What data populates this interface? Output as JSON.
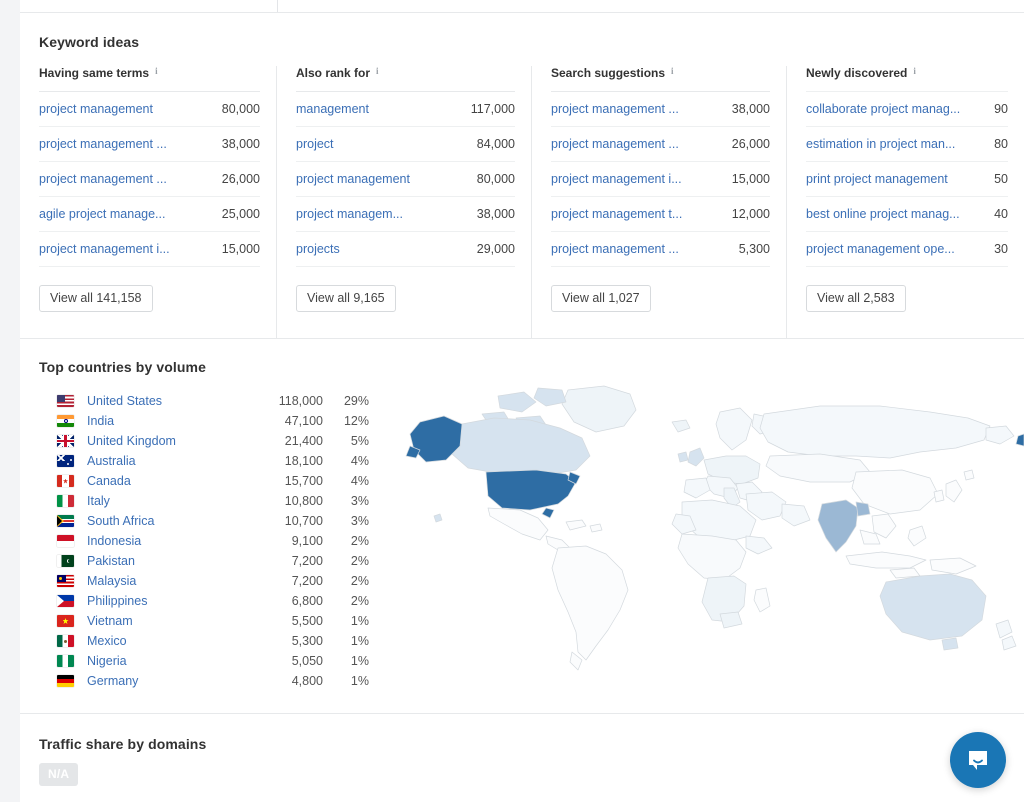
{
  "keyword_ideas": {
    "title": "Keyword ideas",
    "columns": [
      {
        "header": "Having same terms",
        "info_icon": "info-icon",
        "rows": [
          {
            "term": "project management",
            "volume": "80,000"
          },
          {
            "term": "project management ...",
            "volume": "38,000"
          },
          {
            "term": "project management ...",
            "volume": "26,000"
          },
          {
            "term": "agile project manage...",
            "volume": "25,000"
          },
          {
            "term": "project management i...",
            "volume": "15,000"
          }
        ],
        "view_all": "View all 141,158"
      },
      {
        "header": "Also rank for",
        "info_icon": "info-icon",
        "rows": [
          {
            "term": "management",
            "volume": "117,000"
          },
          {
            "term": "project",
            "volume": "84,000"
          },
          {
            "term": "project management",
            "volume": "80,000"
          },
          {
            "term": "project managem...",
            "volume": "38,000"
          },
          {
            "term": "projects",
            "volume": "29,000"
          }
        ],
        "view_all": "View all 9,165"
      },
      {
        "header": "Search suggestions",
        "info_icon": "info-icon",
        "rows": [
          {
            "term": "project management ...",
            "volume": "38,000"
          },
          {
            "term": "project management ...",
            "volume": "26,000"
          },
          {
            "term": "project management i...",
            "volume": "15,000"
          },
          {
            "term": "project management t...",
            "volume": "12,000"
          },
          {
            "term": "project management ...",
            "volume": "5,300"
          }
        ],
        "view_all": "View all 1,027"
      },
      {
        "header": "Newly discovered",
        "info_icon": "info-icon",
        "rows": [
          {
            "term": "collaborate project manag...",
            "volume": "90"
          },
          {
            "term": "estimation in project man...",
            "volume": "80"
          },
          {
            "term": "print project management",
            "volume": "50"
          },
          {
            "term": "best online project manag...",
            "volume": "40"
          },
          {
            "term": "project management ope...",
            "volume": "30"
          }
        ],
        "view_all": "View all 2,583"
      }
    ]
  },
  "top_countries": {
    "title": "Top countries by volume",
    "rows": [
      {
        "country": "United States",
        "flag": "flag-us",
        "volume": "118,000",
        "share": "29%"
      },
      {
        "country": "India",
        "flag": "flag-in",
        "volume": "47,100",
        "share": "12%"
      },
      {
        "country": "United Kingdom",
        "flag": "flag-gb",
        "volume": "21,400",
        "share": "5%"
      },
      {
        "country": "Australia",
        "flag": "flag-au",
        "volume": "18,100",
        "share": "4%"
      },
      {
        "country": "Canada",
        "flag": "flag-ca",
        "volume": "15,700",
        "share": "4%"
      },
      {
        "country": "Italy",
        "flag": "flag-it",
        "volume": "10,800",
        "share": "3%"
      },
      {
        "country": "South Africa",
        "flag": "flag-za",
        "volume": "10,700",
        "share": "3%"
      },
      {
        "country": "Indonesia",
        "flag": "flag-id",
        "volume": "9,100",
        "share": "2%"
      },
      {
        "country": "Pakistan",
        "flag": "flag-pk",
        "volume": "7,200",
        "share": "2%"
      },
      {
        "country": "Malaysia",
        "flag": "flag-my",
        "volume": "7,200",
        "share": "2%"
      },
      {
        "country": "Philippines",
        "flag": "flag-ph",
        "volume": "6,800",
        "share": "2%"
      },
      {
        "country": "Vietnam",
        "flag": "flag-vn",
        "volume": "5,500",
        "share": "1%"
      },
      {
        "country": "Mexico",
        "flag": "flag-mx",
        "volume": "5,300",
        "share": "1%"
      },
      {
        "country": "Nigeria",
        "flag": "flag-ng",
        "volume": "5,050",
        "share": "1%"
      },
      {
        "country": "Germany",
        "flag": "flag-de",
        "volume": "4,800",
        "share": "1%"
      }
    ],
    "map": {
      "type": "choropleth",
      "highlight_colors": {
        "strong": "#2e6da4",
        "medium": "#9bb8d4",
        "light": "#d6e3ef",
        "faint": "#eef4f8",
        "base": "#fbfcfd",
        "stroke": "#d3d9de"
      },
      "highlighted": [
        {
          "region": "United States",
          "level": "strong"
        },
        {
          "region": "Alaska",
          "level": "strong"
        },
        {
          "region": "India",
          "level": "medium"
        },
        {
          "region": "Canada",
          "level": "light"
        },
        {
          "region": "Australia",
          "level": "light"
        },
        {
          "region": "United Kingdom",
          "level": "light"
        },
        {
          "region": "South Africa",
          "level": "faint"
        }
      ]
    }
  },
  "traffic_share": {
    "title": "Traffic share by domains",
    "empty_label": "N/A"
  },
  "chat": {
    "icon": "chat-bubble-icon",
    "color": "#1a76b5"
  },
  "theme": {
    "link": "#3b6fb6",
    "text": "#444444",
    "heading": "#323232",
    "divider": "#e7e9eb",
    "page_bg": "#f3f4f6"
  }
}
